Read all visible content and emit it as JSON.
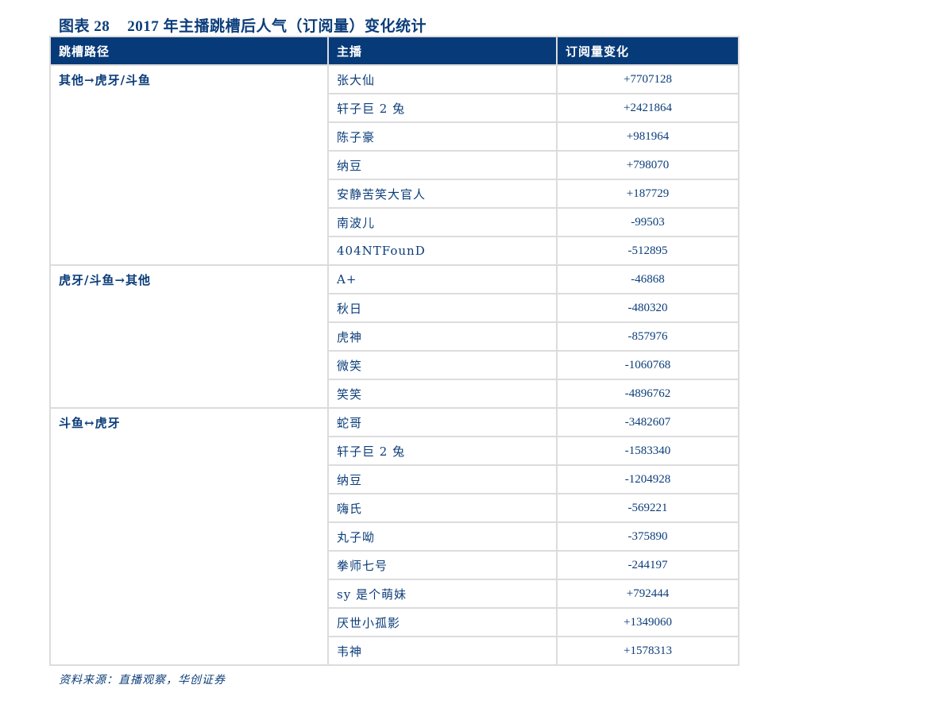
{
  "title": {
    "figure_label": "图表 28",
    "text": "2017 年主播跳槽后人气（订阅量）变化统计"
  },
  "table": {
    "headers": [
      "跳槽路径",
      "主播",
      "订阅量变化"
    ],
    "groups": [
      {
        "route": "其他→虎牙/斗鱼",
        "rows": [
          {
            "streamer": "张大仙",
            "change": "+7707128"
          },
          {
            "streamer": "轩子巨 2 兔",
            "change": "+2421864"
          },
          {
            "streamer": "陈子豪",
            "change": "+981964"
          },
          {
            "streamer": "纳豆",
            "change": "+798070"
          },
          {
            "streamer": "安静苦笑大官人",
            "change": "+187729"
          },
          {
            "streamer": "南波儿",
            "change": "-99503"
          },
          {
            "streamer": "404NTFounD",
            "change": "-512895"
          }
        ]
      },
      {
        "route": "虎牙/斗鱼→其他",
        "rows": [
          {
            "streamer": "A+",
            "change": "-46868"
          },
          {
            "streamer": "秋日",
            "change": "-480320"
          },
          {
            "streamer": "虎神",
            "change": "-857976"
          },
          {
            "streamer": "微笑",
            "change": "-1060768"
          },
          {
            "streamer": "笑笑",
            "change": "-4896762"
          }
        ]
      },
      {
        "route": "斗鱼↔虎牙",
        "rows": [
          {
            "streamer": "蛇哥",
            "change": "-3482607"
          },
          {
            "streamer": "轩子巨 2 兔",
            "change": "-1583340"
          },
          {
            "streamer": "纳豆",
            "change": "-1204928"
          },
          {
            "streamer": "嗨氏",
            "change": "-569221"
          },
          {
            "streamer": "丸子呦",
            "change": "-375890"
          },
          {
            "streamer": "拳师七号",
            "change": "-244197"
          },
          {
            "streamer": "sy 是个萌妹",
            "change": "+792444"
          },
          {
            "streamer": "厌世小孤影",
            "change": "+1349060"
          },
          {
            "streamer": "韦神",
            "change": "+1578313"
          }
        ]
      }
    ]
  },
  "source": "资料来源：直播观察，华创证券",
  "colors": {
    "header_bg": "#073a78",
    "text": "#0b3d7a",
    "border": "#dcdcdc"
  }
}
